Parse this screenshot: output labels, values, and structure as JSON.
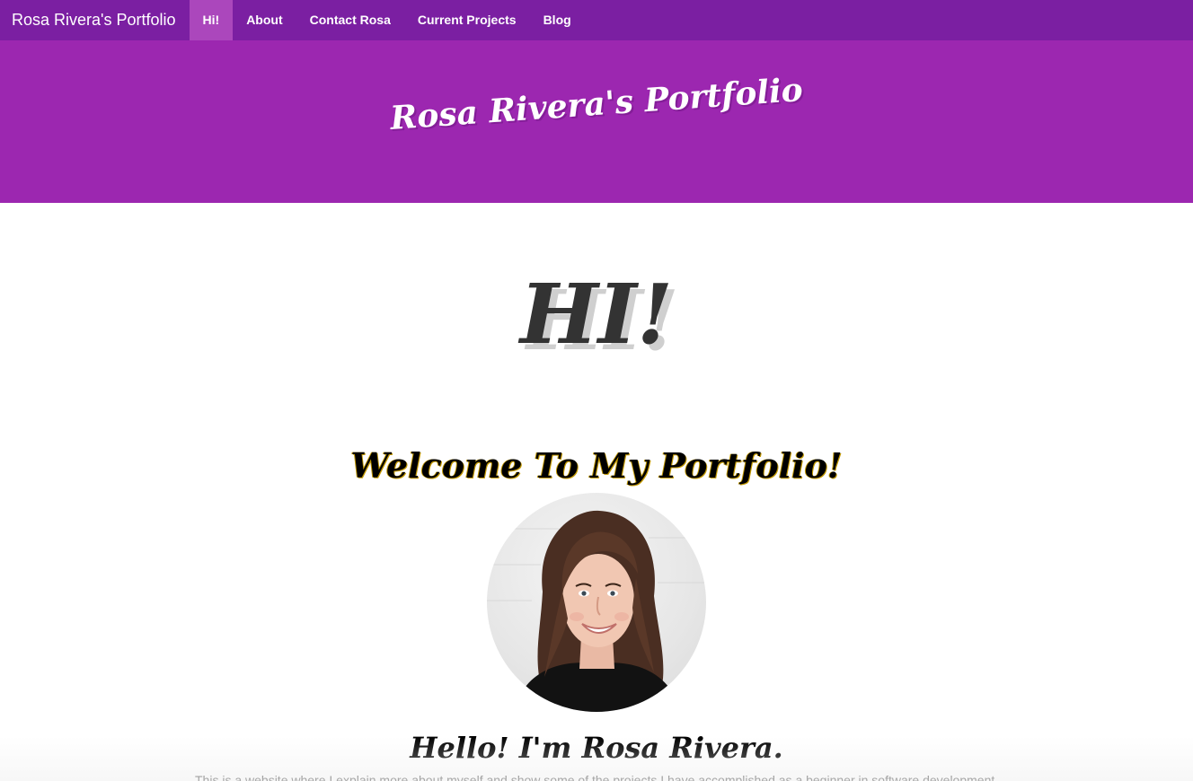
{
  "navbar": {
    "brand": "Rosa Rivera's Portfolio",
    "items": [
      {
        "label": "Hi!",
        "active": true
      },
      {
        "label": "About",
        "active": false
      },
      {
        "label": "Contact Rosa",
        "active": false
      },
      {
        "label": "Current Projects",
        "active": false
      },
      {
        "label": "Blog",
        "active": false
      }
    ]
  },
  "hero": {
    "title": "Rosa Rivera's Portfolio"
  },
  "main": {
    "hi_heading": "HI!",
    "welcome": "Welcome To My Portfolio!",
    "hello": "Hello! I'm Rosa Rivera.",
    "intro": "This is a website where I explain more about myself and show some of the projects I have accomplished as a beginner in software development."
  },
  "icons": {
    "avatar": "profile-photo"
  },
  "colors": {
    "navbar_bg": "#7b1fa2",
    "nav_active_bg": "#ab47bc",
    "hero_bg": "#9c27b0",
    "heading_text": "#333333"
  }
}
